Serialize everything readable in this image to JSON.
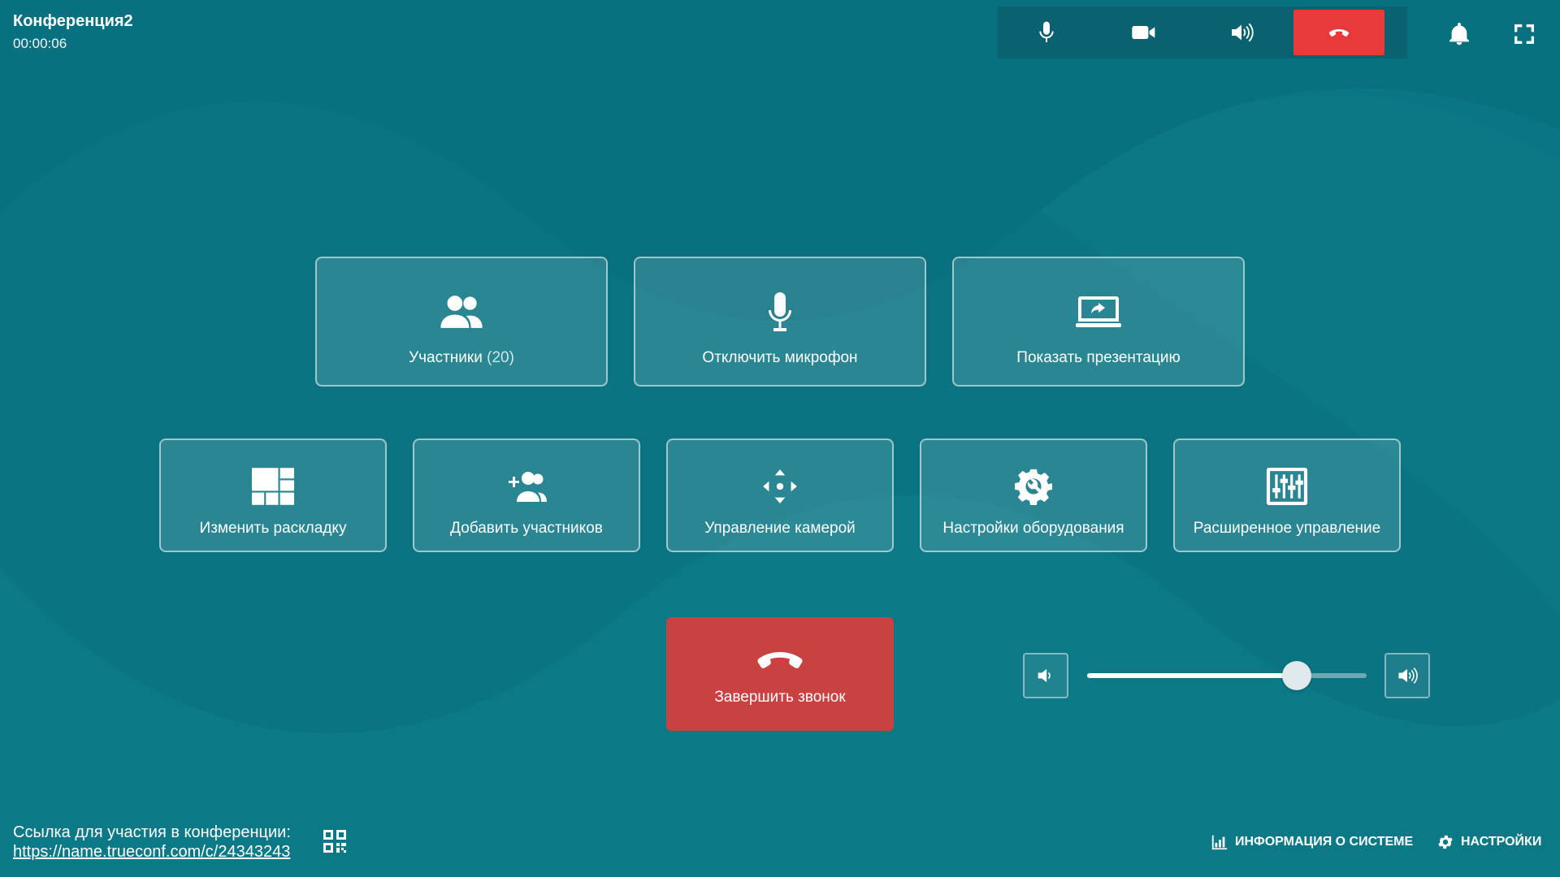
{
  "conference": {
    "title": "Конференция2",
    "timer": "00:00:06"
  },
  "topbar": {
    "buttons": [
      {
        "icon": "microphone-icon"
      },
      {
        "icon": "camera-icon"
      },
      {
        "icon": "speaker-icon"
      },
      {
        "icon": "hangup-icon",
        "color": "#e83a3a"
      }
    ],
    "right_icons": [
      "bell-icon",
      "fullscreen-icon"
    ]
  },
  "actions": {
    "participants": {
      "label": "Участники",
      "count": "(20)"
    },
    "mute_mic": {
      "label": "Отключить микрофон"
    },
    "presentation": {
      "label": "Показать презентацию"
    },
    "layout": {
      "label": "Изменить раскладку"
    },
    "add_participants": {
      "label": "Добавить участников"
    },
    "camera_control": {
      "label": "Управление камерой"
    },
    "hardware_settings": {
      "label": "Настройки оборудования"
    },
    "advanced_control": {
      "label": "Расширенное управление"
    },
    "end_call": {
      "label": "Завершить звонок",
      "color": "#c94141"
    }
  },
  "volume": {
    "level": 0.75
  },
  "footer": {
    "link_label": "Ссылка для участия в конференции:",
    "link_url": "https://name.trueconf.com/c/24343243",
    "system_info": "ИНФОРМАЦИЯ О СИСТЕМЕ",
    "settings": "НАСТРОЙКИ"
  },
  "colors": {
    "background": "#0b7482",
    "accent_red": "#e83a3a"
  }
}
